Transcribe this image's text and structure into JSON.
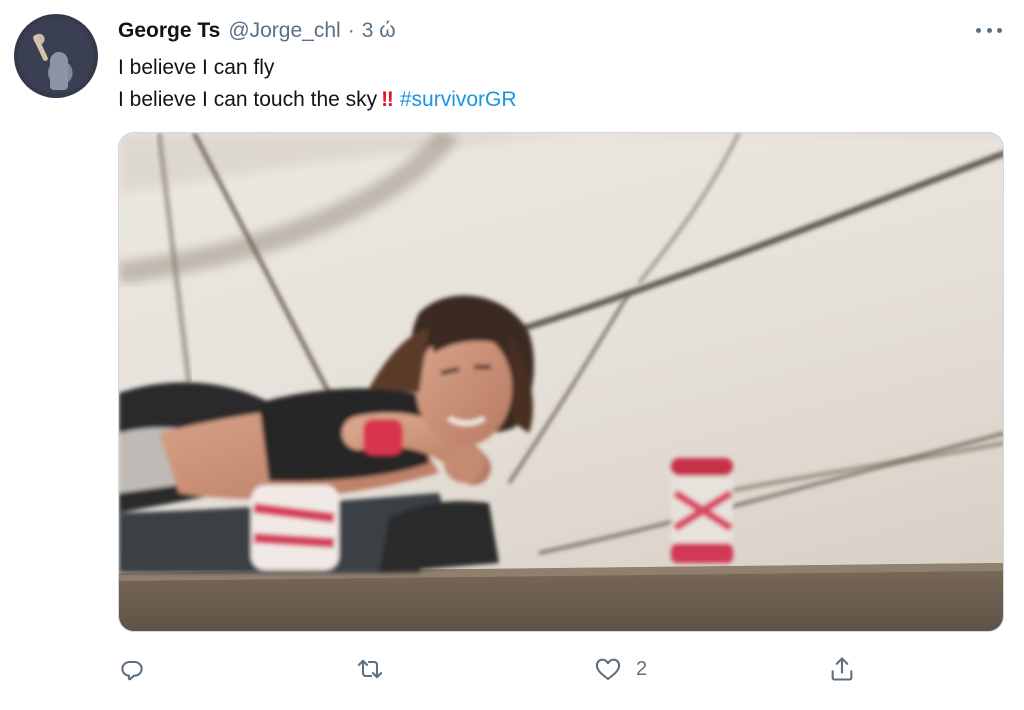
{
  "tweet": {
    "author_name": "George Ts",
    "author_handle": "@Jorge_chl",
    "separator": "·",
    "time": "3 ώ",
    "text_line1": "I believe I can fly",
    "text_line2": "I believe I can touch the sky",
    "emphasis": "‼",
    "hashtag": "#survivorGR",
    "media_icon": "photo-of-woman-on-rope-course"
  },
  "actions": {
    "reply_icon": "reply-icon",
    "retweet_icon": "retweet-icon",
    "like_icon": "like-icon",
    "like_count": "2",
    "share_icon": "share-icon"
  },
  "colors": {
    "text": "#0f1419",
    "secondary": "#5b7083",
    "link": "#1b95e0",
    "emphasis": "#d81b2c"
  }
}
